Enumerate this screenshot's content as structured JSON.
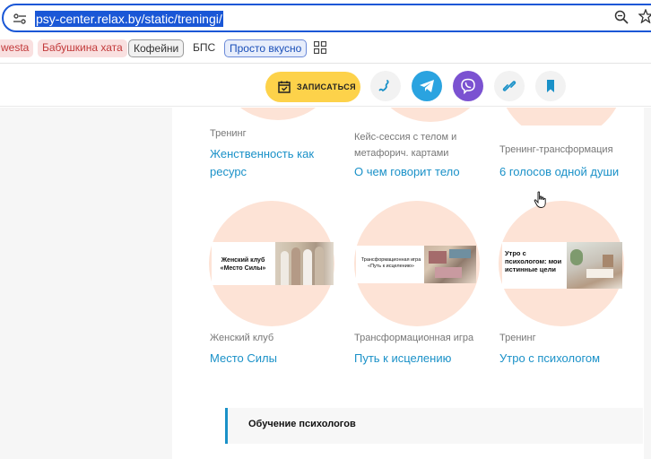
{
  "browser": {
    "url": "psy-center.relax.by/static/treningi/",
    "bookmarks": [
      {
        "label": "westa"
      },
      {
        "label": "Бабушкина хата"
      },
      {
        "label": "Кофейни"
      },
      {
        "label": "БПС"
      },
      {
        "label": "Просто вкусно"
      }
    ]
  },
  "header": {
    "signup_label": "ЗАПИСАТЬСЯ",
    "colors": {
      "signup": "#fdd24a",
      "phone": "#f2f2f2",
      "telegram": "#2aa3e0",
      "viber": "#7b52d1",
      "link": "#f2f2f2",
      "bookmark": "#f2f2f2"
    }
  },
  "cards": [
    {
      "category": "Тренинг",
      "title": "Женственность как ресурс"
    },
    {
      "category": "Кейс-сессия с телом и метафорич. картами",
      "title": "О чем говорит тело"
    },
    {
      "category": "Тренинг-трансформация",
      "title": "6 голосов одной души"
    },
    {
      "category": "Женский клуб",
      "title": "Место Силы",
      "image_text": "Женский клуб «Место Силы»"
    },
    {
      "category": "Трансформационная игра",
      "title": "Путь к исцелению",
      "image_text": "Трансформационная игра «Путь к исцелению»"
    },
    {
      "category": "Тренинг",
      "title": "Утро с психологом",
      "image_text": "Утро с психологом: мои истинные цели"
    }
  ],
  "section": {
    "label": "Обучение психологов"
  }
}
